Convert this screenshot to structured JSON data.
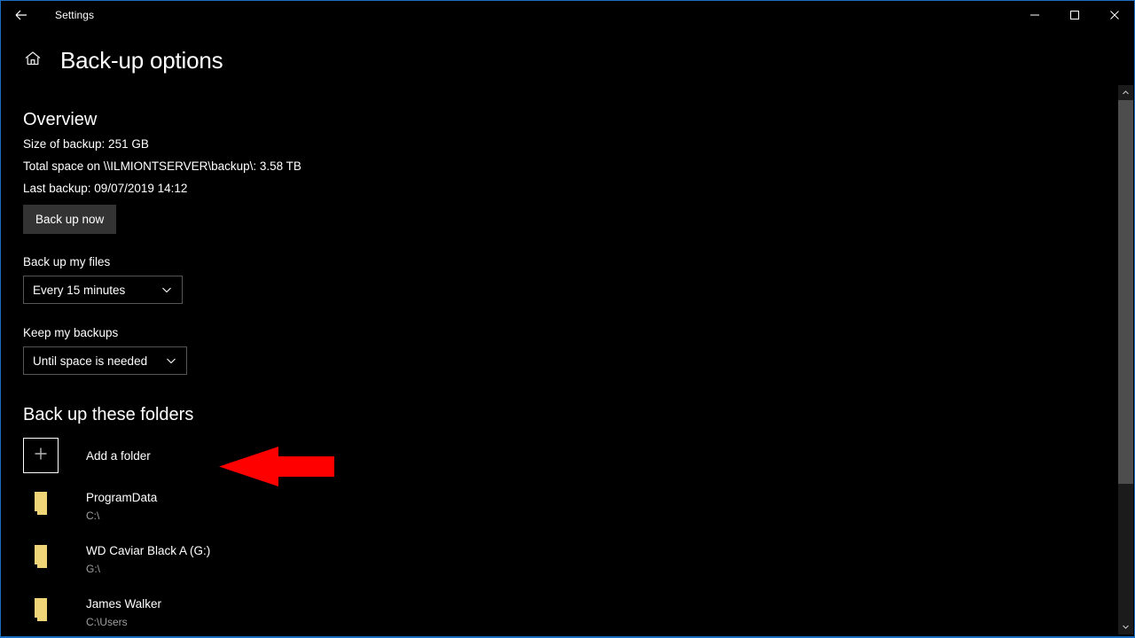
{
  "titlebar": {
    "back_icon": "back-arrow-icon",
    "app_title": "Settings",
    "minimize_label": "Minimize",
    "maximize_label": "Maximize",
    "close_label": "Close"
  },
  "header": {
    "home_icon": "home-icon",
    "page_title": "Back-up options"
  },
  "overview": {
    "heading": "Overview",
    "size_line": "Size of backup: 251 GB",
    "space_line": "Total space on \\\\ILMIONTSERVER\\backup\\: 3.58 TB",
    "last_backup_line": "Last backup: 09/07/2019 14:12",
    "backup_now_label": "Back up now"
  },
  "backup_frequency": {
    "label": "Back up my files",
    "selected": "Every 15 minutes",
    "chevron_icon": "chevron-down-icon"
  },
  "keep_backups": {
    "label": "Keep my backups",
    "selected": "Until space is needed",
    "chevron_icon": "chevron-down-icon"
  },
  "folders": {
    "heading": "Back up these folders",
    "add_label": "Add a folder",
    "add_icon": "plus-icon",
    "items": [
      {
        "icon": "folder-icon",
        "name": "ProgramData",
        "path": "C:\\"
      },
      {
        "icon": "folder-icon",
        "name": "WD Caviar Black A (G:)",
        "path": "G:\\"
      },
      {
        "icon": "folder-icon",
        "name": "James Walker",
        "path": "C:\\Users"
      }
    ]
  },
  "scrollbar": {
    "up_icon": "chevron-up-icon",
    "down_icon": "chevron-down-icon",
    "thumb_label": "scroll-thumb"
  },
  "annotation": {
    "arrow_icon": "red-left-arrow",
    "color": "#FF0000"
  },
  "colors": {
    "background": "#000000",
    "window_border": "#1a6fc4",
    "button_fill": "#333333",
    "combo_border": "#555555",
    "folder_icon": "#f0d478",
    "path_text": "#a0a0a0",
    "scroll_thumb": "#4d4d4d"
  }
}
